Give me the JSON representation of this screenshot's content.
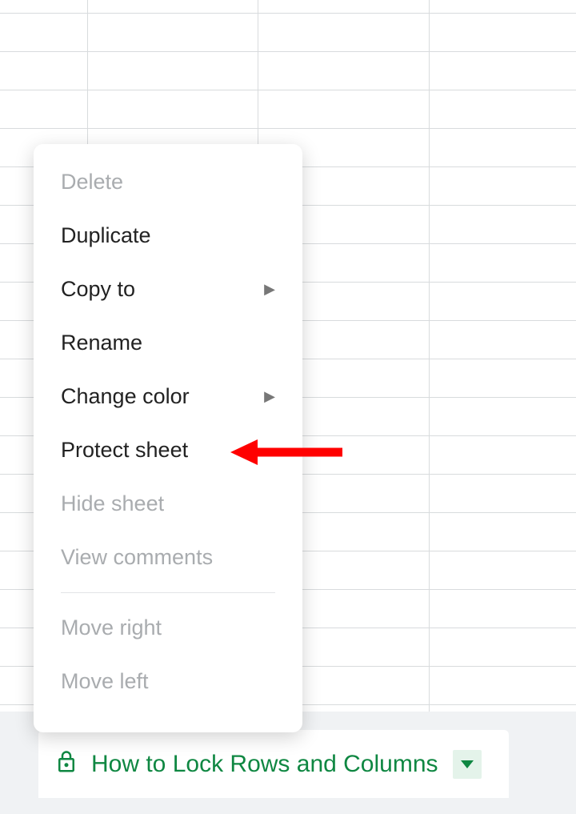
{
  "menu": {
    "items": [
      {
        "label": "Delete",
        "disabled": true,
        "submenu": false
      },
      {
        "label": "Duplicate",
        "disabled": false,
        "submenu": false
      },
      {
        "label": "Copy to",
        "disabled": false,
        "submenu": true
      },
      {
        "label": "Rename",
        "disabled": false,
        "submenu": false
      },
      {
        "label": "Change color",
        "disabled": false,
        "submenu": true
      },
      {
        "label": "Protect sheet",
        "disabled": false,
        "submenu": false
      },
      {
        "label": "Hide sheet",
        "disabled": true,
        "submenu": false
      },
      {
        "label": "View comments",
        "disabled": true,
        "submenu": false
      },
      {
        "label": "Move right",
        "disabled": true,
        "submenu": false
      },
      {
        "label": "Move left",
        "disabled": true,
        "submenu": false
      }
    ]
  },
  "sheet_tab": {
    "name": "How to Lock Rows and Columns"
  }
}
